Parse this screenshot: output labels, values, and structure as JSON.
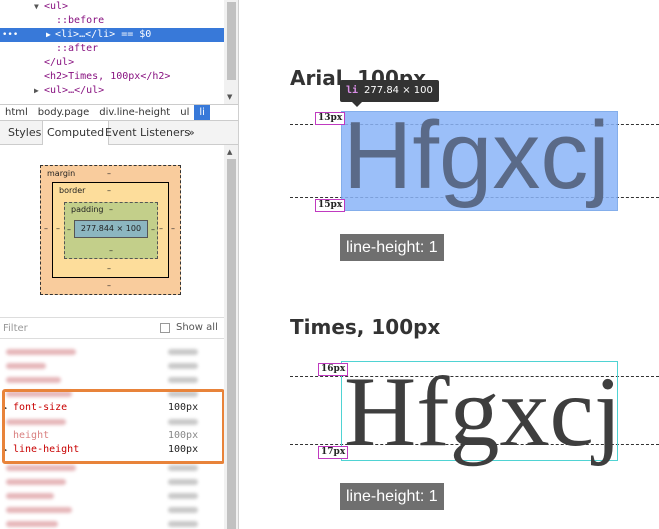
{
  "dom_tree": {
    "lines": [
      {
        "text": "<ul>",
        "indent": "ul"
      },
      {
        "text": "::before"
      },
      {
        "text": "<li>…</li> == $0"
      },
      {
        "text": "::after"
      },
      {
        "text": "</ul>"
      },
      {
        "text": "<h2>Times, 100px</h2>"
      },
      {
        "text": "<ul>…</ul>"
      }
    ],
    "selected_dots": "•••"
  },
  "breadcrumbs": [
    "html",
    "body.page",
    "div.line-height",
    "ul",
    "li"
  ],
  "tabs": [
    "Styles",
    "Computed",
    "Event Listeners",
    "»"
  ],
  "box_model": {
    "margin_label": "margin",
    "border_label": "border",
    "padding_label": "padding",
    "dash": "–",
    "content_size": "277.844 × 100"
  },
  "filter": {
    "placeholder": "Filter",
    "show_all": "Show all"
  },
  "properties": [
    {
      "name": "font-size",
      "value": "100px",
      "faded": false
    },
    {
      "name": "height",
      "value": "100px",
      "faded": true
    },
    {
      "name": "line-height",
      "value": "100px",
      "faded": false
    }
  ],
  "page": {
    "arial": {
      "title": "Arial, 100px",
      "sample": "Hfgxcj",
      "top_gap": "13px",
      "bottom_gap": "15px",
      "badge": "line-height: 1"
    },
    "times": {
      "title": "Times, 100px",
      "sample": "Hfgxcj",
      "top_gap": "16px",
      "bottom_gap": "17px",
      "badge": "line-height: 1"
    },
    "tooltip": {
      "tag": "li",
      "size": "277.84 × 100"
    }
  },
  "colors": {
    "selection": "#3879d9",
    "highlight": "#e8833a",
    "arial_overlay": "#8ab4f8",
    "times_outline": "#4fd3d3"
  }
}
